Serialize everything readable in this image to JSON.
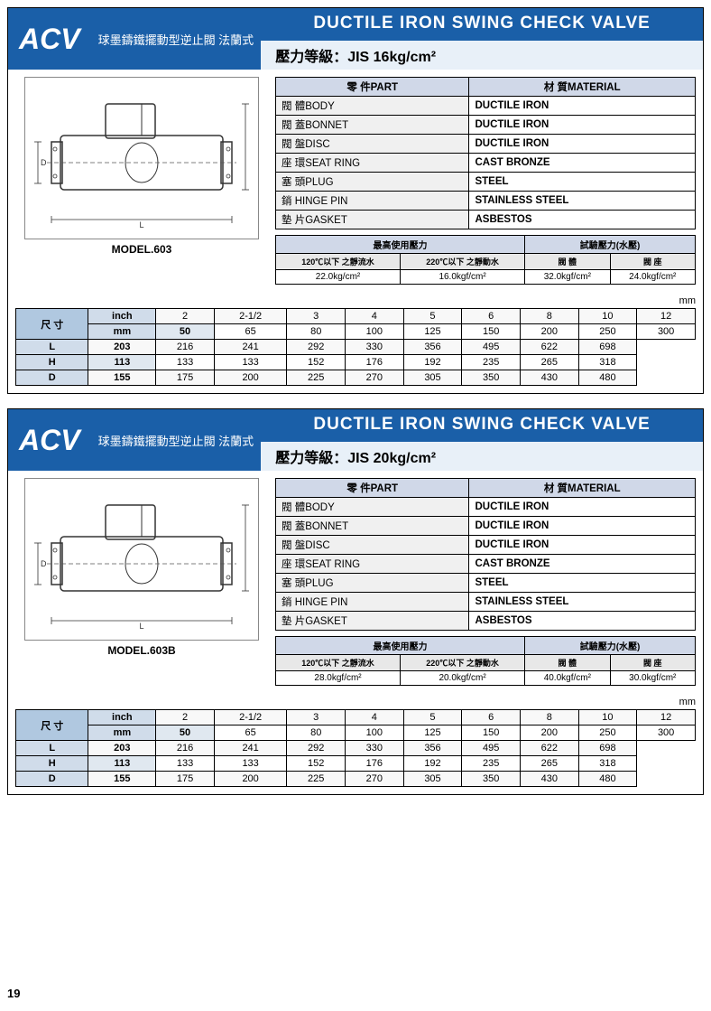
{
  "section1": {
    "acv": "ACV",
    "subtitle": "球墨鑄鐵擺動型逆止閥 法蘭式",
    "title_main": "DUCTILE  IRON  SWING  CHECK  VALVE",
    "title_sub": "壓力等級：JIS 16kg/cm²",
    "model": "MODEL.603",
    "parts": {
      "header": [
        "零 件PART",
        "材 質MATERIAL"
      ],
      "rows": [
        [
          "閥 體BODY",
          "DUCTILE IRON"
        ],
        [
          "閥 蓋BONNET",
          "DUCTILE IRON"
        ],
        [
          "閥 盤DISC",
          "DUCTILE IRON"
        ],
        [
          "座 環SEAT RING",
          "CAST BRONZE"
        ],
        [
          "塞 頭PLUG",
          "STEEL"
        ],
        [
          "銷   HINGE PIN",
          "STAINLESS STEEL"
        ],
        [
          "墊 片GASKET",
          "ASBESTOS"
        ]
      ]
    },
    "pressure": {
      "col1_header": "最高使用壓力",
      "col2_header": "試驗壓力(水壓)",
      "sub_headers": [
        "120℃以下\n之靜流水",
        "220℃以下\n之靜動水",
        "閥 體",
        "閥 座"
      ],
      "values": [
        "22.0kg/cm²",
        "16.0kgf/cm²",
        "32.0kgf/cm²",
        "24.0kgf/cm²"
      ]
    },
    "mm": "mm",
    "dim_table": {
      "size_label": "尺 寸",
      "rows_header": [
        "inch",
        "mm",
        "L",
        "H",
        "D"
      ],
      "cols": [
        "2",
        "2-1/2",
        "3",
        "4",
        "5",
        "6",
        "8",
        "10",
        "12"
      ],
      "inch": [
        "2",
        "2-1/2",
        "3",
        "4",
        "5",
        "6",
        "8",
        "10",
        "12"
      ],
      "mm": [
        "50",
        "65",
        "80",
        "100",
        "125",
        "150",
        "200",
        "250",
        "300"
      ],
      "L": [
        "203",
        "216",
        "241",
        "292",
        "330",
        "356",
        "495",
        "622",
        "698"
      ],
      "H": [
        "113",
        "133",
        "133",
        "152",
        "176",
        "192",
        "235",
        "265",
        "318"
      ],
      "D": [
        "155",
        "175",
        "200",
        "225",
        "270",
        "305",
        "350",
        "430",
        "480"
      ]
    }
  },
  "section2": {
    "acv": "ACV",
    "subtitle": "球墨鑄鐵擺動型逆止閥 法蘭式",
    "title_main": "DUCTILE  IRON  SWING  CHECK  VALVE",
    "title_sub": "壓力等級：JIS 20kg/cm²",
    "model": "MODEL.603B",
    "parts": {
      "header": [
        "零 件PART",
        "材 質MATERIAL"
      ],
      "rows": [
        [
          "閥 體BODY",
          "DUCTILE IRON"
        ],
        [
          "閥 蓋BONNET",
          "DUCTILE IRON"
        ],
        [
          "閥 盤DISC",
          "DUCTILE IRON"
        ],
        [
          "座 環SEAT RING",
          "CAST BRONZE"
        ],
        [
          "塞 頭PLUG",
          "STEEL"
        ],
        [
          "銷   HINGE PIN",
          "STAINLESS STEEL"
        ],
        [
          "墊 片GASKET",
          "ASBESTOS"
        ]
      ]
    },
    "pressure": {
      "col1_header": "最高使用壓力",
      "col2_header": "試驗壓力(水壓)",
      "sub_headers": [
        "120℃以下\n之靜流水",
        "220℃以下\n之靜動水",
        "閥 體",
        "閥 座"
      ],
      "values": [
        "28.0kgf/cm²",
        "20.0kgf/cm²",
        "40.0kgf/cm²",
        "30.0kgf/cm²"
      ]
    },
    "mm": "mm",
    "dim_table": {
      "size_label": "尺 寸",
      "rows_header": [
        "inch",
        "mm",
        "L",
        "H",
        "D"
      ],
      "cols": [
        "2",
        "2-1/2",
        "3",
        "4",
        "5",
        "6",
        "8",
        "10",
        "12"
      ],
      "inch": [
        "2",
        "2-1/2",
        "3",
        "4",
        "5",
        "6",
        "8",
        "10",
        "12"
      ],
      "mm": [
        "50",
        "65",
        "80",
        "100",
        "125",
        "150",
        "200",
        "250",
        "300"
      ],
      "L": [
        "203",
        "216",
        "241",
        "292",
        "330",
        "356",
        "495",
        "622",
        "698"
      ],
      "H": [
        "113",
        "133",
        "133",
        "152",
        "176",
        "192",
        "235",
        "265",
        "318"
      ],
      "D": [
        "155",
        "175",
        "200",
        "225",
        "270",
        "305",
        "350",
        "430",
        "480"
      ]
    }
  },
  "page_number": "19"
}
